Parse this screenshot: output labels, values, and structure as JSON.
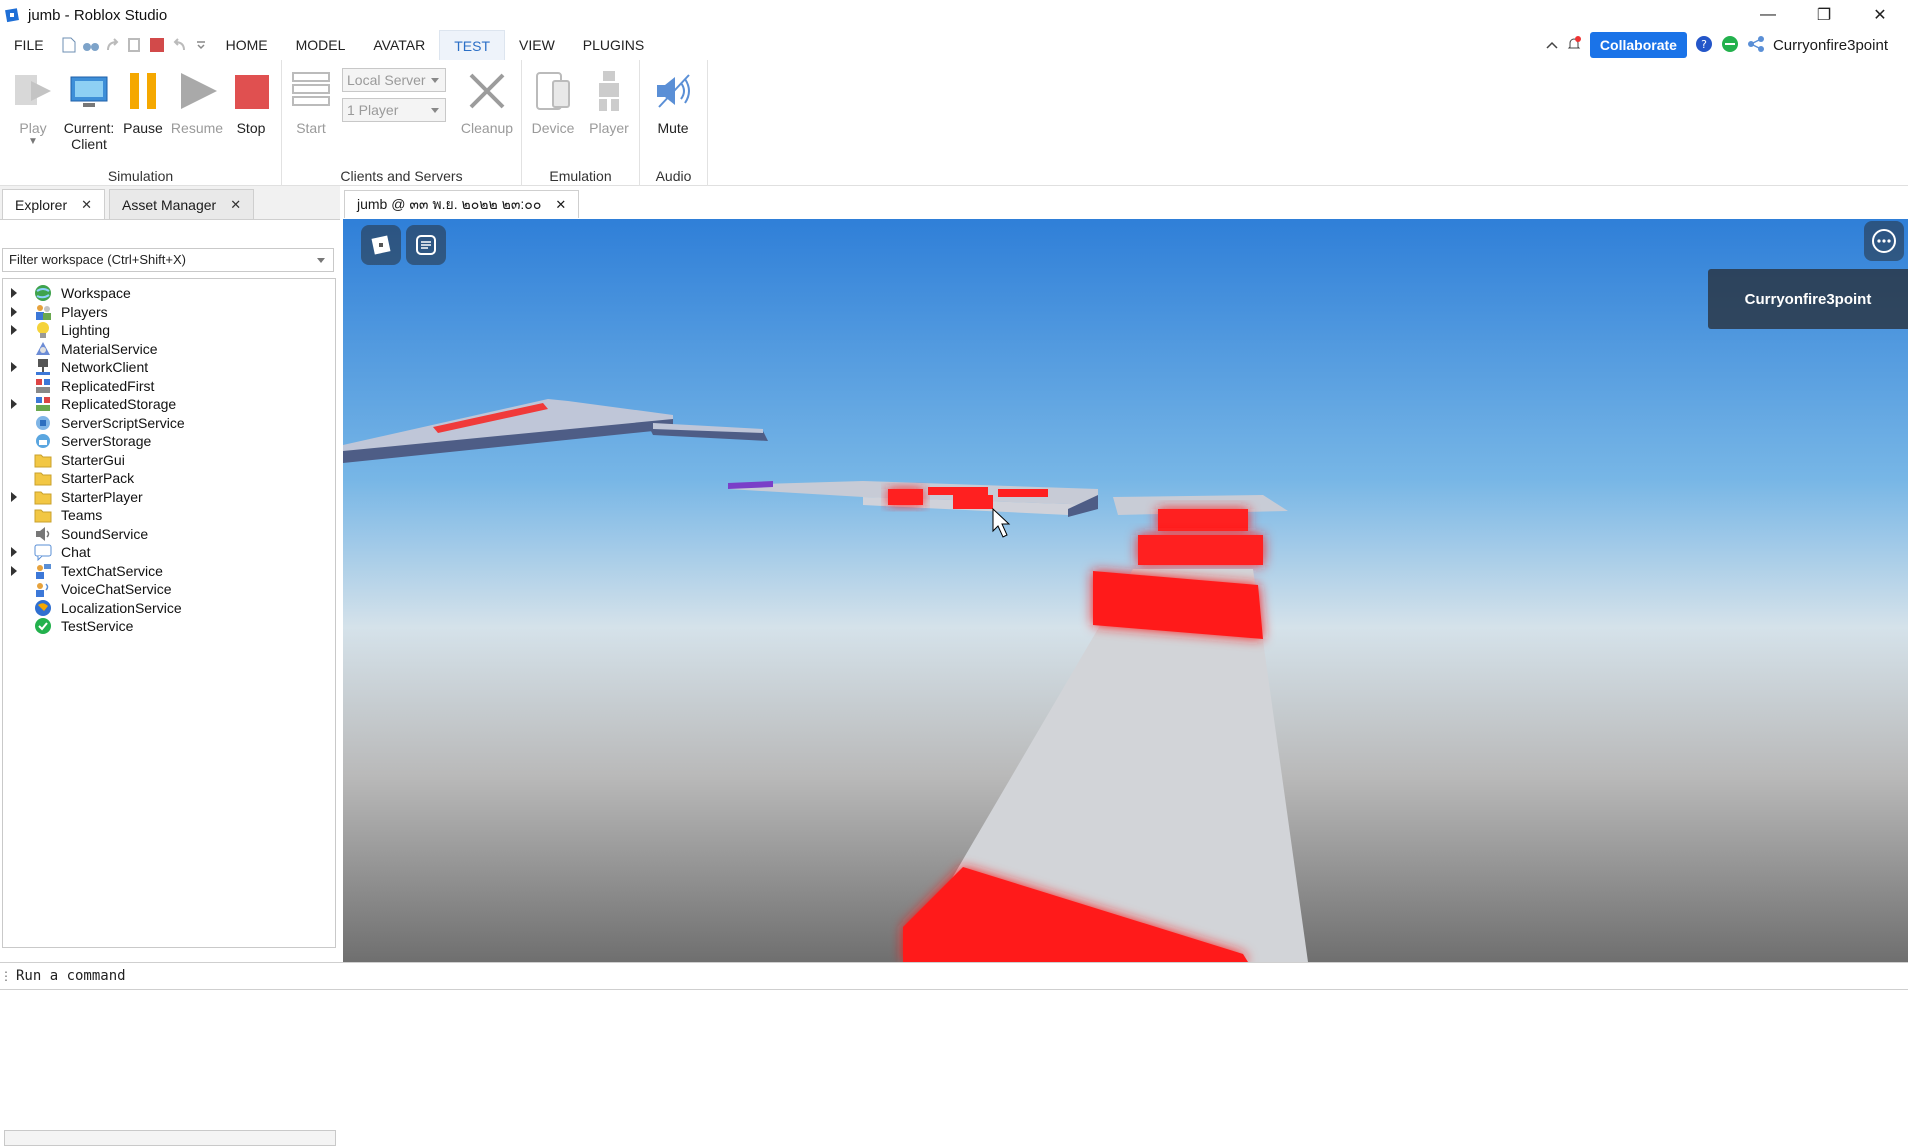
{
  "window": {
    "title": "jumb - Roblox Studio"
  },
  "menu": {
    "tabs": [
      "FILE",
      "HOME",
      "MODEL",
      "AVATAR",
      "TEST",
      "VIEW",
      "PLUGINS"
    ],
    "active_tab": "TEST",
    "collaborate_label": "Collaborate",
    "username": "Curryonfire3point"
  },
  "ribbon": {
    "simulation": {
      "label": "Simulation",
      "play": "Play",
      "current_client_line1": "Current:",
      "current_client_line2": "Client",
      "pause": "Pause",
      "resume": "Resume",
      "stop": "Stop"
    },
    "clients_servers": {
      "label": "Clients and Servers",
      "start": "Start",
      "server_select": "Local Server",
      "player_select": "1 Player",
      "cleanup": "Cleanup"
    },
    "emulation": {
      "label": "Emulation",
      "device": "Device",
      "player": "Player"
    },
    "audio": {
      "label": "Audio",
      "mute": "Mute"
    }
  },
  "explorer": {
    "tabs": [
      {
        "label": "Explorer"
      },
      {
        "label": "Asset Manager"
      }
    ],
    "filter_placeholder": "Filter workspace (Ctrl+Shift+X)",
    "items": [
      {
        "label": "Workspace",
        "expandable": true,
        "icon": "globe-icon"
      },
      {
        "label": "Players",
        "expandable": true,
        "icon": "players-icon"
      },
      {
        "label": "Lighting",
        "expandable": true,
        "icon": "lightbulb-icon"
      },
      {
        "label": "MaterialService",
        "expandable": false,
        "icon": "material-icon"
      },
      {
        "label": "NetworkClient",
        "expandable": true,
        "icon": "network-icon"
      },
      {
        "label": "ReplicatedFirst",
        "expandable": false,
        "icon": "replicated-icon"
      },
      {
        "label": "ReplicatedStorage",
        "expandable": true,
        "icon": "replicated-storage-icon"
      },
      {
        "label": "ServerScriptService",
        "expandable": false,
        "icon": "server-script-icon"
      },
      {
        "label": "ServerStorage",
        "expandable": false,
        "icon": "server-storage-icon"
      },
      {
        "label": "StarterGui",
        "expandable": false,
        "icon": "folder-icon"
      },
      {
        "label": "StarterPack",
        "expandable": false,
        "icon": "folder-icon"
      },
      {
        "label": "StarterPlayer",
        "expandable": true,
        "icon": "folder-icon"
      },
      {
        "label": "Teams",
        "expandable": false,
        "icon": "folder-icon"
      },
      {
        "label": "SoundService",
        "expandable": false,
        "icon": "speaker-icon"
      },
      {
        "label": "Chat",
        "expandable": true,
        "icon": "chat-icon"
      },
      {
        "label": "TextChatService",
        "expandable": true,
        "icon": "text-chat-icon"
      },
      {
        "label": "VoiceChatService",
        "expandable": false,
        "icon": "voice-chat-icon"
      },
      {
        "label": "LocalizationService",
        "expandable": false,
        "icon": "localization-icon"
      },
      {
        "label": "TestService",
        "expandable": false,
        "icon": "check-icon"
      }
    ]
  },
  "viewport": {
    "tab_label": "jumb @ ๓๓ พ.ย. ๒๐๒๒ ๒๓:๐๐",
    "player_name": "Curryonfire3point"
  },
  "command_bar": {
    "placeholder": "Run a command"
  },
  "colors": {
    "accent": "#1a73e8",
    "active_tab": "#2b6fc6",
    "brick_red": "#ff1a1a",
    "sky_top": "#2f7fd8"
  }
}
